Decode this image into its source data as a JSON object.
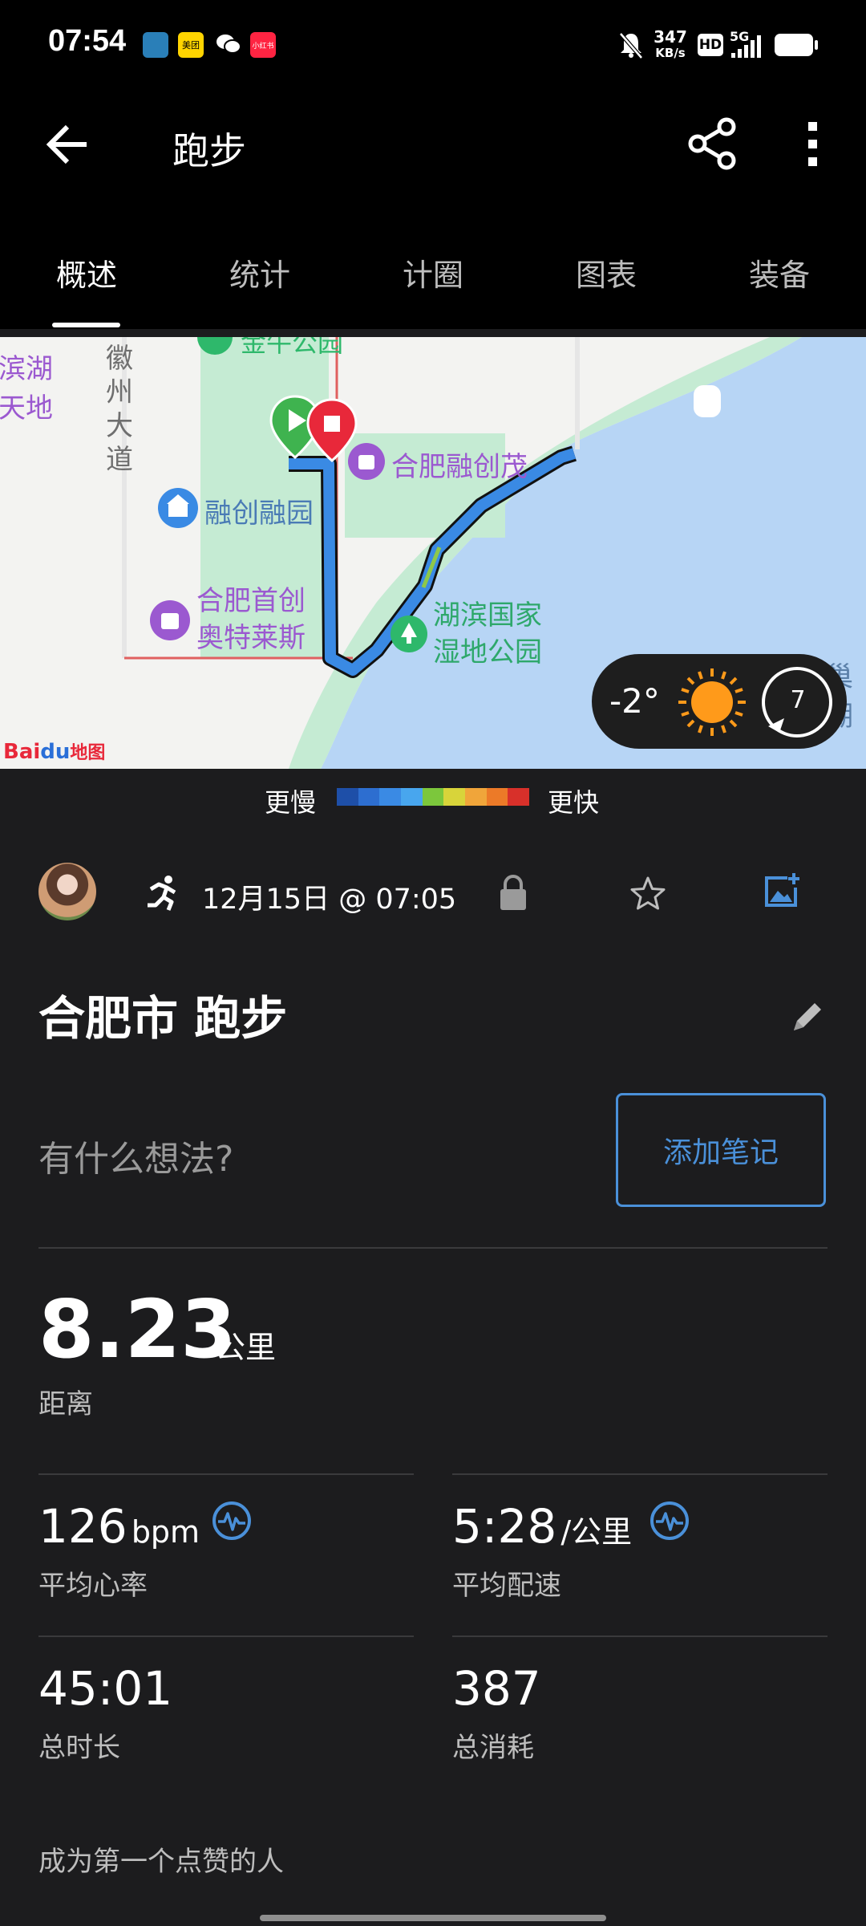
{
  "status_bar": {
    "time": "07:54",
    "app_icons": [
      "meituan-icon-label",
      "美团",
      "wechat-icon",
      "小红书"
    ],
    "network_speed_value": "347",
    "network_speed_unit": "KB/s",
    "hd_badge": "HD",
    "network_type": "5G"
  },
  "header": {
    "title": "跑步",
    "back_icon": "arrow-left-icon",
    "share_icon": "share-icon",
    "menu_icon": "more-vert-icon"
  },
  "tabs": [
    {
      "label": "概述",
      "active": true
    },
    {
      "label": "统计",
      "active": false
    },
    {
      "label": "计圈",
      "active": false
    },
    {
      "label": "图表",
      "active": false
    },
    {
      "label": "装备",
      "active": false
    }
  ],
  "map": {
    "labels": {
      "top_park": "金牛公园",
      "binhu_1": "滨湖",
      "binhu_2": "天地",
      "huizhou_1": "徽",
      "huizhou_2": "州",
      "huizhou_3": "大",
      "huizhou_4": "道",
      "rongchuang_mall": "合肥融创茂",
      "rongchuang_park": "融创融园",
      "outlet_1": "合肥首创",
      "outlet_2": "奥特莱斯",
      "wetland_1": "湖滨国家",
      "wetland_2": "湿地公园",
      "chaohu": "巢湖",
      "baidu_logo_1": "Bai",
      "baidu_logo_2": "du",
      "baidu_logo_3": "地图"
    },
    "weather": {
      "temperature": "-2°",
      "wind": "7"
    },
    "colors": {
      "water": "#b7d5f5",
      "park": "#c5ebd3",
      "route": "#3a8ae4"
    }
  },
  "legend": {
    "slower": "更慢",
    "faster": "更快",
    "colors": [
      "#1e4fa8",
      "#2d6ed0",
      "#3a8ae4",
      "#48a6ee",
      "#7cc73c",
      "#d8d43a",
      "#f0a53a",
      "#ec7a28",
      "#d8302a"
    ]
  },
  "activity": {
    "date": "12月15日 @ 07:05",
    "title": "合肥市 跑步",
    "thought_placeholder": "有什么想法?",
    "add_note": "添加笔记"
  },
  "stats": {
    "distance": {
      "value": "8.23",
      "unit": "公里",
      "label": "距离"
    },
    "heart_rate": {
      "value": "126",
      "unit": "bpm",
      "label": "平均心率"
    },
    "pace": {
      "value": "5:28",
      "unit": "/公里",
      "label": "平均配速"
    },
    "duration": {
      "value": "45:01",
      "label": "总时长"
    },
    "calories": {
      "value": "387",
      "label": "总消耗"
    }
  },
  "likes": "成为第一个点赞的人",
  "accent_color": "#4a90d9"
}
